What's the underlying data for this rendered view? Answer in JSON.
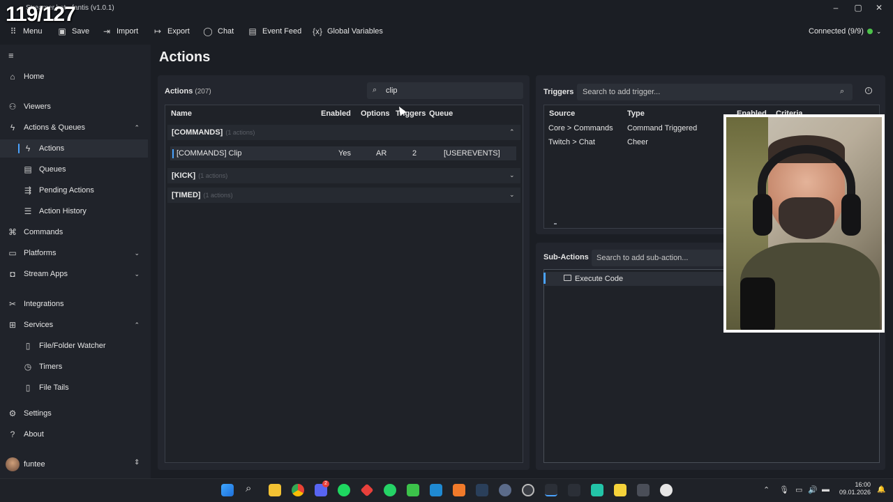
{
  "overlay": {
    "counter": "119/127"
  },
  "window": {
    "title": "Streamer.bot - fantis (v1.0.1)"
  },
  "menubar": {
    "items": [
      {
        "label": "Menu",
        "icon": "grid-icon"
      },
      {
        "label": "Save",
        "icon": "save-icon"
      },
      {
        "label": "Import",
        "icon": "import-icon"
      },
      {
        "label": "Export",
        "icon": "export-icon"
      },
      {
        "label": "Chat",
        "icon": "chat-icon"
      },
      {
        "label": "Event Feed",
        "icon": "list-icon"
      },
      {
        "label": "Global Variables",
        "icon": "variable-icon"
      }
    ],
    "status": "Connected (9/9)",
    "status_color": "#4cc24a"
  },
  "sidebar": {
    "items": [
      {
        "label": "Home"
      },
      {
        "label": "Viewers"
      },
      {
        "label": "Actions & Queues"
      },
      {
        "label": "Actions"
      },
      {
        "label": "Queues"
      },
      {
        "label": "Pending Actions"
      },
      {
        "label": "Action History"
      },
      {
        "label": "Commands"
      },
      {
        "label": "Platforms"
      },
      {
        "label": "Stream Apps"
      },
      {
        "label": "Integrations"
      },
      {
        "label": "Services"
      },
      {
        "label": "File/Folder Watcher"
      },
      {
        "label": "Timers"
      },
      {
        "label": "File Tails"
      },
      {
        "label": "Settings"
      },
      {
        "label": "About"
      }
    ],
    "user": "funtee"
  },
  "main": {
    "title": "Actions",
    "actions": {
      "label": "Actions",
      "count": "(207)",
      "search_value": "clip",
      "columns": [
        "Name",
        "Enabled",
        "Options",
        "Triggers",
        "Queue"
      ],
      "groups": [
        {
          "name": "[COMMANDS]",
          "sub": "(1 actions)",
          "expanded": true
        },
        {
          "name": "[KICK]",
          "sub": "(1 actions)",
          "expanded": false
        },
        {
          "name": "[TIMED]",
          "sub": "(1 actions)",
          "expanded": false
        }
      ],
      "row": {
        "name": "[COMMANDS] Clip",
        "enabled": "Yes",
        "options": "AR",
        "triggers": "2",
        "queue": "[USEREVENTS]"
      }
    },
    "triggers": {
      "label": "Triggers",
      "search_placeholder": "Search to add trigger...",
      "columns": [
        "Source",
        "Type",
        "Enabled",
        "Criteria"
      ],
      "rows": [
        {
          "source": "Core > Commands",
          "type": "Command Triggered"
        },
        {
          "source": "Twitch > Chat",
          "type": "Cheer"
        }
      ]
    },
    "sub_actions": {
      "label": "Sub-Actions",
      "search_placeholder": "Search to add sub-action...",
      "items": [
        {
          "label": "Execute Code"
        }
      ]
    }
  },
  "taskbar": {
    "time": "16:00",
    "date": "09.01.2026",
    "discord_badge": "2",
    "accent": "#4aa3ff"
  }
}
